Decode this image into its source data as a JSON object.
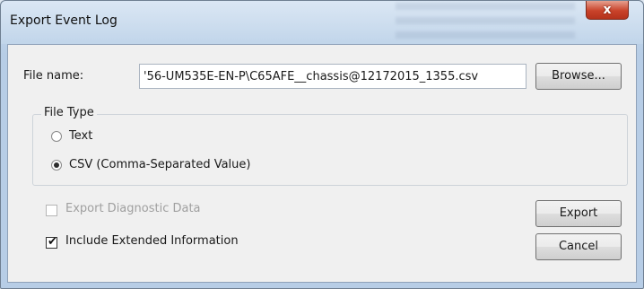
{
  "window": {
    "title": "Export Event Log",
    "close_glyph": "x"
  },
  "file_name": {
    "label": "File name:",
    "value": "'56-UM535E-EN-P\\C65AFE__chassis@12172015_1355.csv",
    "browse_label": "Browse..."
  },
  "file_type": {
    "group_label": "File Type",
    "options": [
      {
        "label": "Text",
        "selected": false
      },
      {
        "label": "CSV (Comma-Separated Value)",
        "selected": true
      }
    ]
  },
  "options": {
    "export_diagnostic": {
      "label": "Export Diagnostic Data",
      "checked": false,
      "enabled": false
    },
    "include_extended": {
      "label": "Include Extended Information",
      "checked": true,
      "enabled": true
    }
  },
  "actions": {
    "export_label": "Export",
    "cancel_label": "Cancel"
  },
  "icons": {
    "close": "close-icon",
    "check": "✔"
  }
}
